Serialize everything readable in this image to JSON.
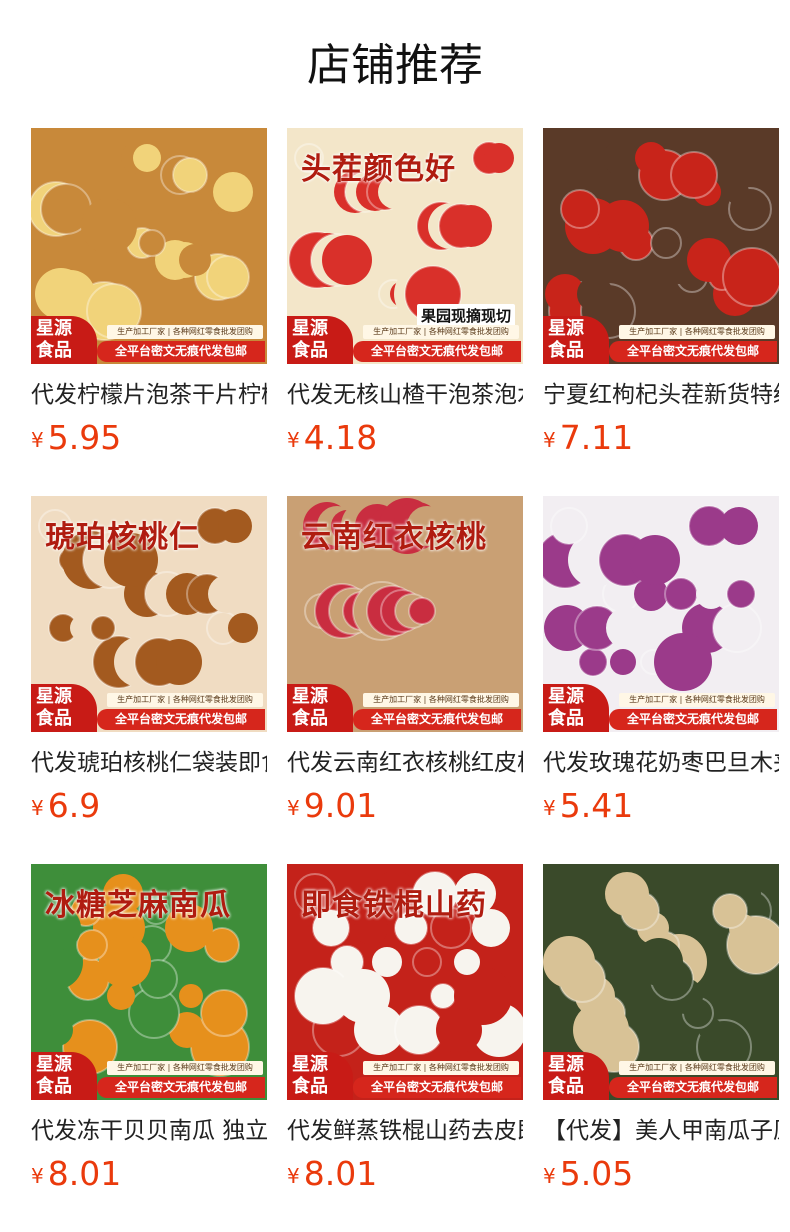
{
  "section_title": "店铺推荐",
  "badge": {
    "brand": "星源\n食品",
    "note": "生产加工厂家 | 各种网红零食批发团购",
    "slogan": "全平台密文无痕代发包邮"
  },
  "currency": "¥",
  "products": [
    {
      "name": "代发柠檬片泡茶干片柠檬",
      "price": "5.95",
      "image": "dried-lemon-slices",
      "overlay": "",
      "overlay_sub": "",
      "colors": [
        "#f1d37a",
        "#c8893a"
      ]
    },
    {
      "name": "代发无核山楂干泡茶泡水",
      "price": "4.18",
      "image": "dried-hawthorn",
      "overlay": "头茬颜色好",
      "overlay_sub": "果园现摘现切",
      "colors": [
        "#d9302a",
        "#f3e6c9"
      ]
    },
    {
      "name": "宁夏红枸杞头茬新货特级",
      "price": "7.11",
      "image": "goji-berries",
      "overlay": "",
      "overlay_sub": "",
      "colors": [
        "#c8241a",
        "#5a3a28"
      ]
    },
    {
      "name": "代发琥珀核桃仁袋装即食",
      "price": "6.9",
      "image": "amber-walnuts",
      "overlay": "琥珀核桃仁",
      "overlay_sub": "",
      "colors": [
        "#a35a1f",
        "#f0dcc2"
      ]
    },
    {
      "name": "代发云南红衣核桃红皮核桃",
      "price": "9.01",
      "image": "red-skin-walnuts",
      "overlay": "云南红衣核桃",
      "overlay_sub": "",
      "colors": [
        "#c92d40",
        "#c9a074"
      ]
    },
    {
      "name": "代发玫瑰花奶枣巴旦木夹心",
      "price": "5.41",
      "image": "rose-milk-dates",
      "overlay": "",
      "overlay_sub": "",
      "colors": [
        "#9b3a8a",
        "#f2eef2"
      ]
    },
    {
      "name": "代发冻干贝贝南瓜 独立包装",
      "price": "8.01",
      "image": "sesame-pumpkin",
      "overlay": "冰糖芝麻南瓜",
      "overlay_sub": "",
      "colors": [
        "#e6901c",
        "#3e8e3a"
      ]
    },
    {
      "name": "代发鲜蒸铁棍山药去皮即食",
      "price": "8.01",
      "image": "yam-sticks",
      "overlay": "即食铁棍山药",
      "overlay_sub": "",
      "colors": [
        "#f7f4ee",
        "#c4221a"
      ]
    },
    {
      "name": "【代发】美人甲南瓜子原味",
      "price": "5.05",
      "image": "pumpkin-seeds",
      "overlay": "",
      "overlay_sub": "",
      "colors": [
        "#d8c296",
        "#3a4a2a"
      ]
    }
  ]
}
